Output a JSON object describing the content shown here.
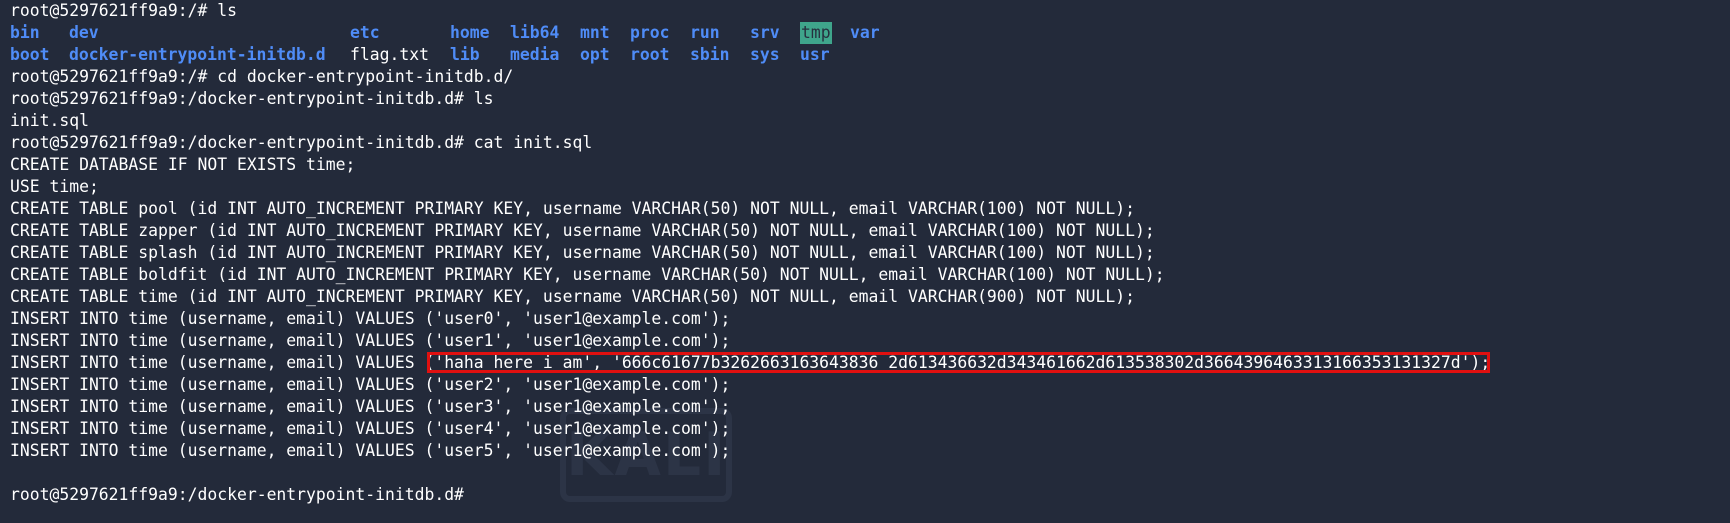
{
  "colors": {
    "background": "#232a3a",
    "directory": "#4f8cf7",
    "text": "#ffffff",
    "tmp_highlight": "#3fa58b",
    "annotation_box": "#e01010"
  },
  "lines": {
    "l0": "root@5297621ff9a9:/# ls",
    "l3": "root@5297621ff9a9:/# cd docker-entrypoint-initdb.d/",
    "l4": "root@5297621ff9a9:/docker-entrypoint-initdb.d# ls",
    "l5": "init.sql",
    "l6": "root@5297621ff9a9:/docker-entrypoint-initdb.d# cat init.sql",
    "l7": "CREATE DATABASE IF NOT EXISTS time;",
    "l8": "USE time;",
    "l9": "CREATE TABLE pool (id INT AUTO_INCREMENT PRIMARY KEY, username VARCHAR(50) NOT NULL, email VARCHAR(100) NOT NULL);",
    "l10": "CREATE TABLE zapper (id INT AUTO_INCREMENT PRIMARY KEY, username VARCHAR(50) NOT NULL, email VARCHAR(100) NOT NULL);",
    "l11": "CREATE TABLE splash (id INT AUTO_INCREMENT PRIMARY KEY, username VARCHAR(50) NOT NULL, email VARCHAR(100) NOT NULL);",
    "l12": "CREATE TABLE boldfit (id INT AUTO_INCREMENT PRIMARY KEY, username VARCHAR(50) NOT NULL, email VARCHAR(100) NOT NULL);",
    "l13": "CREATE TABLE time (id INT AUTO_INCREMENT PRIMARY KEY, username VARCHAR(50) NOT NULL, email VARCHAR(900) NOT NULL);",
    "l14": "INSERT INTO time (username, email) VALUES ('user0', 'user1@example.com');",
    "l15": "INSERT INTO time (username, email) VALUES ('user1', 'user1@example.com');",
    "l16": "INSERT INTO time (username, email) VALUES ('haha_here_i_am', '666c61677b3262663163643836 2d613436632d343461662d613538302d3664396463313166353131327d');",
    "l17": "INSERT INTO time (username, email) VALUES ('user2', 'user1@example.com');",
    "l18": "INSERT INTO time (username, email) VALUES ('user3', 'user1@example.com');",
    "l19": "INSERT INTO time (username, email) VALUES ('user4', 'user1@example.com');",
    "l20": "INSERT INTO time (username, email) VALUES ('user5', 'user1@example.com');",
    "l21": "",
    "l22": "root@5297621ff9a9:/docker-entrypoint-initdb.d# "
  },
  "ls_row1": [
    "bin",
    "dev",
    "etc",
    "home",
    "lib64",
    "mnt",
    "proc",
    "run",
    "srv",
    "tmp",
    "var"
  ],
  "ls_row2": [
    "boot",
    "docker-entrypoint-initdb.d",
    "flag.txt",
    "lib",
    "media",
    "opt",
    "root",
    "sbin",
    "sys",
    "usr"
  ],
  "watermark": "KALI"
}
